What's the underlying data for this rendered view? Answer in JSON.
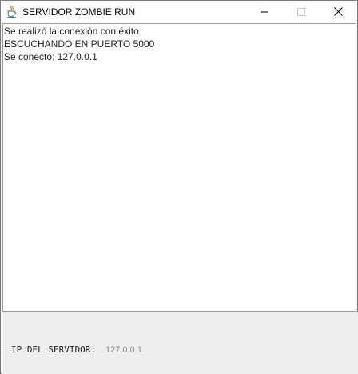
{
  "window": {
    "title": "SERVIDOR ZOMBIE RUN",
    "app_icon": "java-cup-icon",
    "controls": {
      "minimize_icon": "minimize-icon",
      "maximize_icon": "maximize-icon",
      "close_icon": "close-icon"
    }
  },
  "log": {
    "lines": [
      "Se realizó la conexión con éxito",
      "ESCUCHANDO EN PUERTO 5000",
      "Se conecto: 127.0.0.1"
    ]
  },
  "footer": {
    "ip_label": "IP DEL SERVIDOR:",
    "ip_value": "127.0.0.1"
  },
  "colors": {
    "titlebar_bg": "#ffffff",
    "panel_bg": "#eeeeee",
    "text_area_bg": "#ffffff",
    "ip_value_color": "#8a8a8a"
  }
}
